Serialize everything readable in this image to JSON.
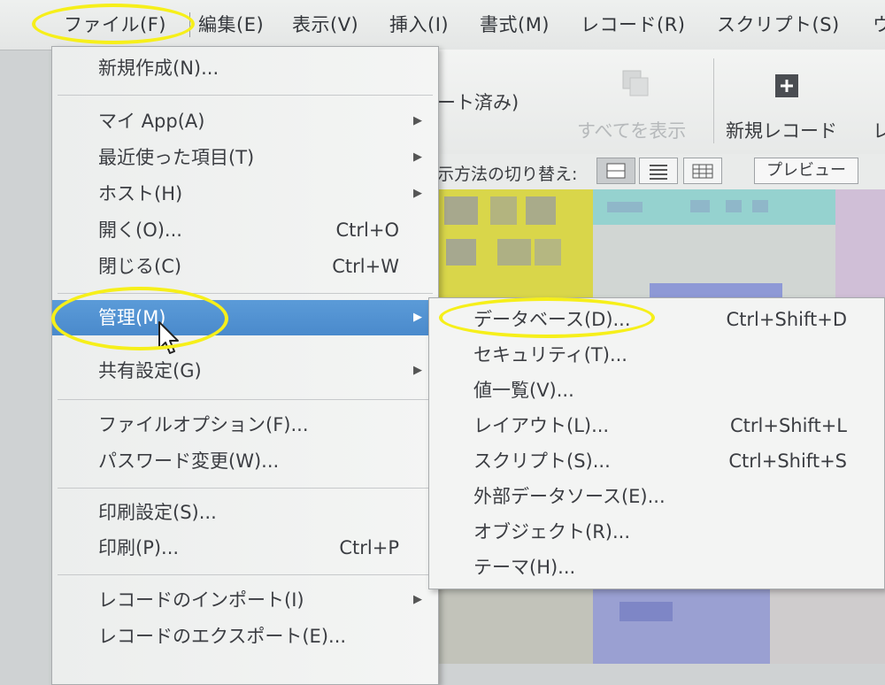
{
  "menubar": {
    "items": [
      {
        "label": "ファイル(F)"
      },
      {
        "label": "編集(E)"
      },
      {
        "label": "表示(V)"
      },
      {
        "label": "挿入(I)"
      },
      {
        "label": "書式(M)"
      },
      {
        "label": "レコード(R)"
      },
      {
        "label": "スクリプト(S)"
      },
      {
        "label": "ウ"
      }
    ]
  },
  "toolbar": {
    "partial_status": "ート済み)",
    "show_all_label": "すべてを表示",
    "new_record_label": "新規レコード",
    "cut_off_label": "レ",
    "view_switch_label": "示方法の切り替え:",
    "preview_label": "プレビュー"
  },
  "file_menu": {
    "items": [
      {
        "label": "新規作成(N)...",
        "shortcut": "",
        "submenu": false
      },
      {
        "label": "マイ App(A)",
        "shortcut": "",
        "submenu": true
      },
      {
        "label": "最近使った項目(T)",
        "shortcut": "",
        "submenu": true
      },
      {
        "label": "ホスト(H)",
        "shortcut": "",
        "submenu": true
      },
      {
        "label": "開く(O)...",
        "shortcut": "Ctrl+O",
        "submenu": false
      },
      {
        "label": "閉じる(C)",
        "shortcut": "Ctrl+W",
        "submenu": false
      },
      {
        "label": "管理(M)",
        "shortcut": "",
        "submenu": true
      },
      {
        "label": "共有設定(G)",
        "shortcut": "",
        "submenu": true
      },
      {
        "label": "ファイルオプション(F)...",
        "shortcut": "",
        "submenu": false
      },
      {
        "label": "パスワード変更(W)...",
        "shortcut": "",
        "submenu": false
      },
      {
        "label": "印刷設定(S)...",
        "shortcut": "",
        "submenu": false
      },
      {
        "label": "印刷(P)...",
        "shortcut": "Ctrl+P",
        "submenu": false
      },
      {
        "label": "レコードのインポート(I)",
        "shortcut": "",
        "submenu": true
      },
      {
        "label": "レコードのエクスポート(E)...",
        "shortcut": "",
        "submenu": false
      }
    ]
  },
  "manage_submenu": {
    "items": [
      {
        "label": "データベース(D)...",
        "shortcut": "Ctrl+Shift+D"
      },
      {
        "label": "セキュリティ(T)...",
        "shortcut": ""
      },
      {
        "label": "値一覧(V)...",
        "shortcut": ""
      },
      {
        "label": "レイアウト(L)...",
        "shortcut": "Ctrl+Shift+L"
      },
      {
        "label": "スクリプト(S)...",
        "shortcut": "Ctrl+Shift+S"
      },
      {
        "label": "外部データソース(E)...",
        "shortcut": ""
      },
      {
        "label": "オブジェクト(R)...",
        "shortcut": ""
      },
      {
        "label": "テーマ(H)...",
        "shortcut": ""
      }
    ]
  },
  "colors": {
    "highlight": "#4a8acc",
    "annotation": "#f6ef1a",
    "menu_bg": "#f3f4f3"
  },
  "icons": [
    "plus-icon",
    "show-all-icon",
    "mouse-pointer-icon",
    "submenu-arrow-icon",
    "form-view-icon",
    "list-view-icon",
    "table-view-icon"
  ]
}
